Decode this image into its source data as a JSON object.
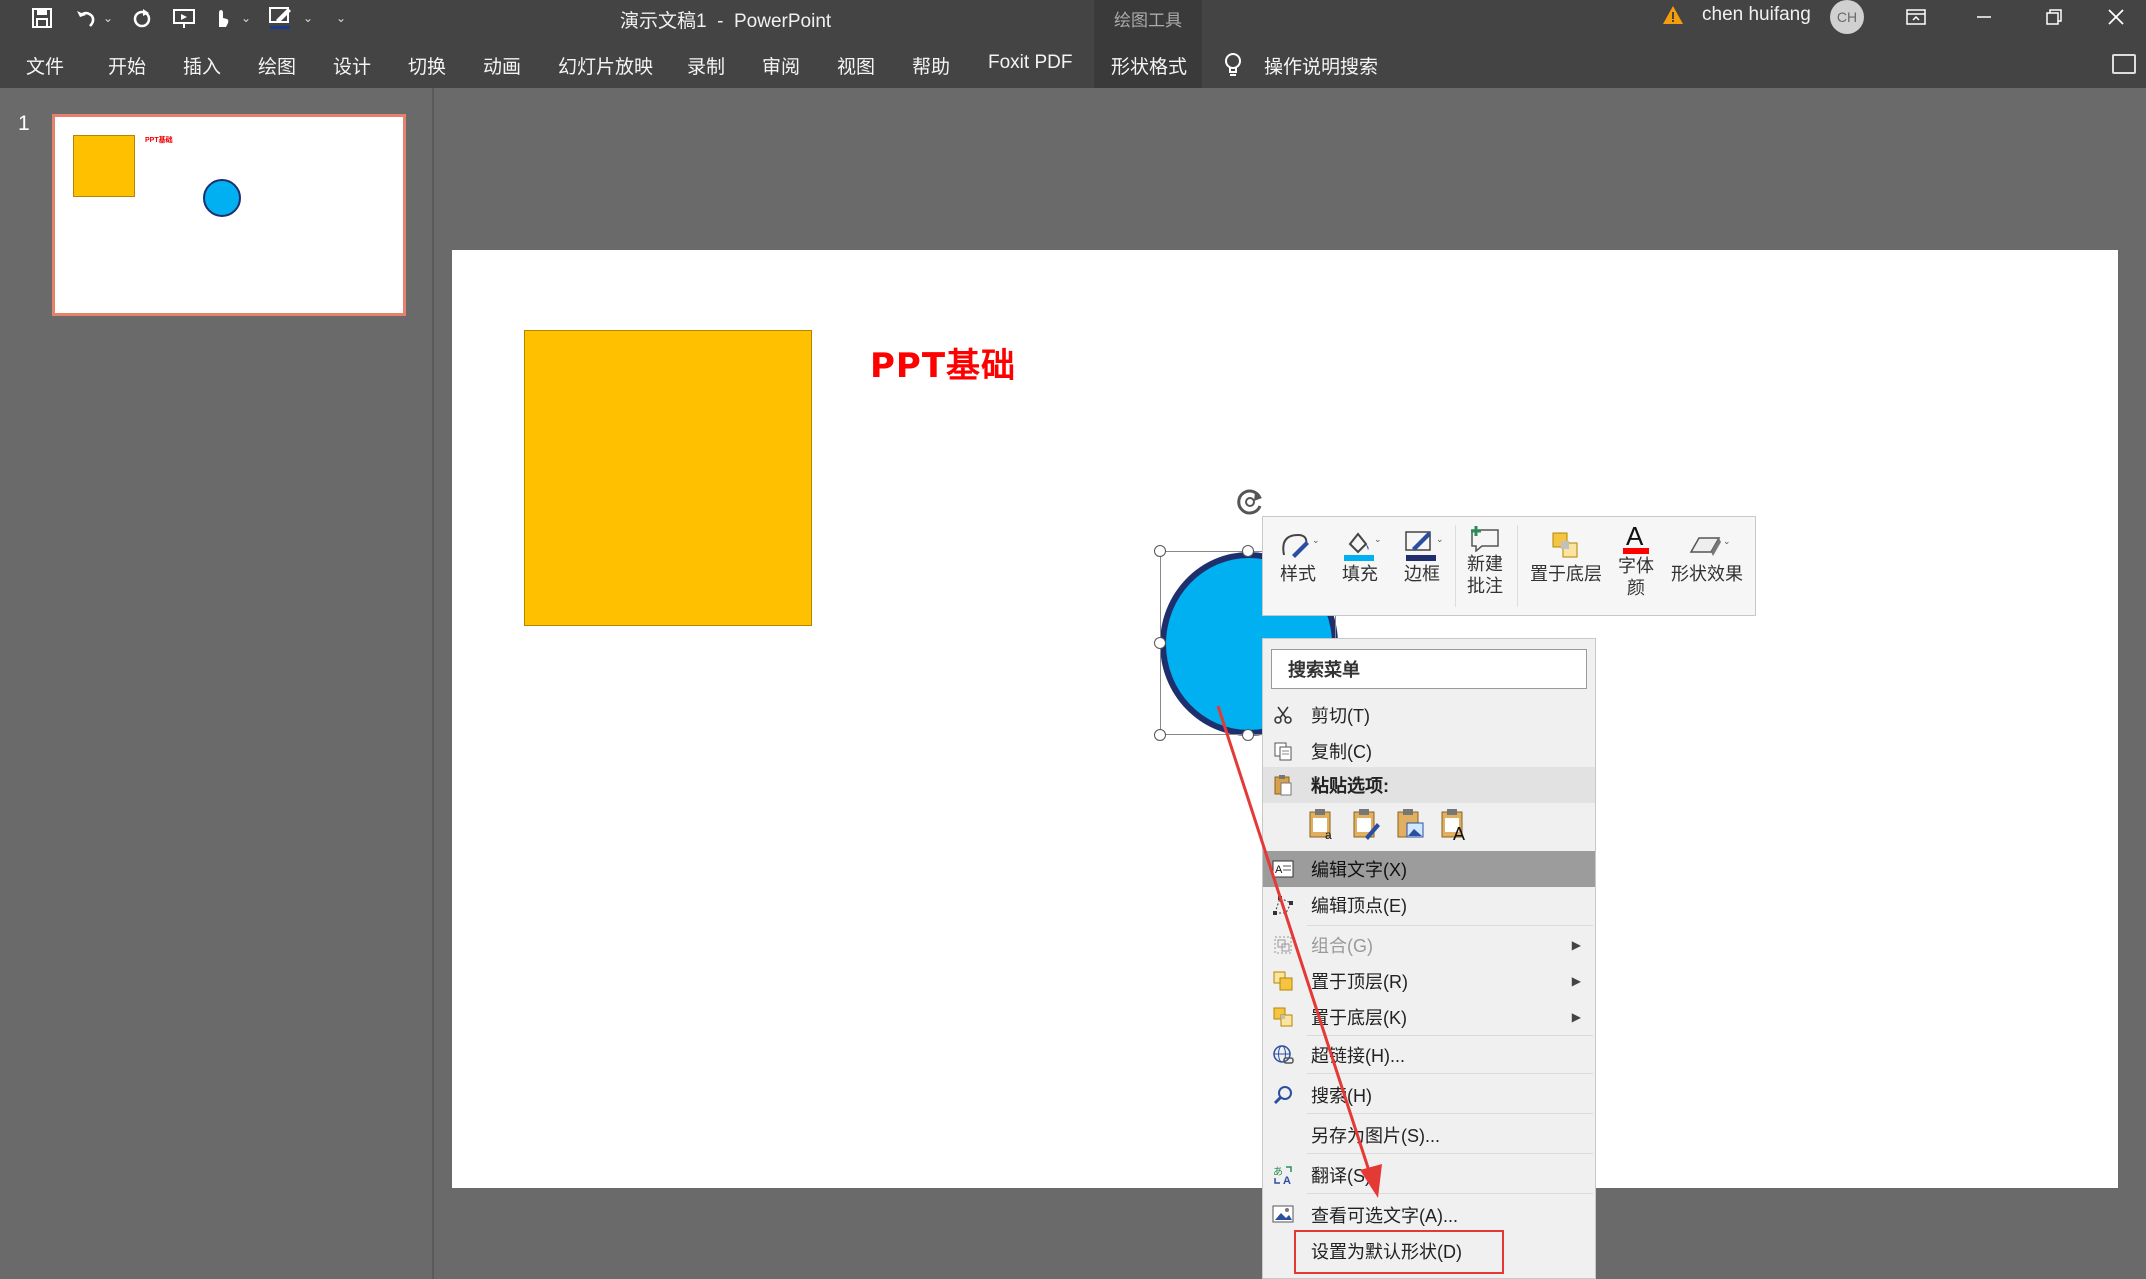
{
  "window": {
    "title": "演示文稿1  -  PowerPoint",
    "contextual_group": "绘图工具",
    "user_name": "chen huifang",
    "user_initials": "CH"
  },
  "quick_access": {
    "icons": [
      "save-icon",
      "undo-icon",
      "redo-icon",
      "present-icon",
      "touch-icon",
      "pen-icon",
      "customize-icon"
    ]
  },
  "ribbon": {
    "tabs": [
      "文件",
      "开始",
      "插入",
      "绘图",
      "设计",
      "切换",
      "动画",
      "幻灯片放映",
      "录制",
      "审阅",
      "视图",
      "帮助",
      "Foxit PDF",
      "形状格式"
    ],
    "active_tab": "形状格式",
    "tell_me": "操作说明搜索"
  },
  "thumbnails": {
    "slide_number": "1",
    "thumb_title": "PPT基础"
  },
  "slide": {
    "title_text": "PPT基础",
    "colors": {
      "square": "#ffc000",
      "circle_fill": "#00b0f0",
      "circle_border": "#1f2f6e",
      "title": "#ff0000"
    }
  },
  "mini_toolbar": {
    "style": "样式",
    "fill": "填充",
    "outline": "边框",
    "new_comment_1": "新建",
    "new_comment_2": "批注",
    "send_back": "置于底层",
    "font_color_1": "字体",
    "font_color_2": "颜",
    "shape_effects": "形状效果"
  },
  "context_menu": {
    "search": "搜索菜单",
    "cut": "剪切(T)",
    "copy": "复制(C)",
    "paste_options": "粘贴选项:",
    "edit_text": "编辑文字(X)",
    "edit_points": "编辑顶点(E)",
    "group": "组合(G)",
    "bring_front": "置于顶层(R)",
    "send_back": "置于底层(K)",
    "hyperlink": "超链接(H)...",
    "search_item": "搜索(H)",
    "save_as_picture": "另存为图片(S)...",
    "translate": "翻译(S)",
    "alt_text": "查看可选文字(A)...",
    "set_default": "设置为默认形状(D)"
  },
  "annotation": {
    "color": "#e53935"
  }
}
